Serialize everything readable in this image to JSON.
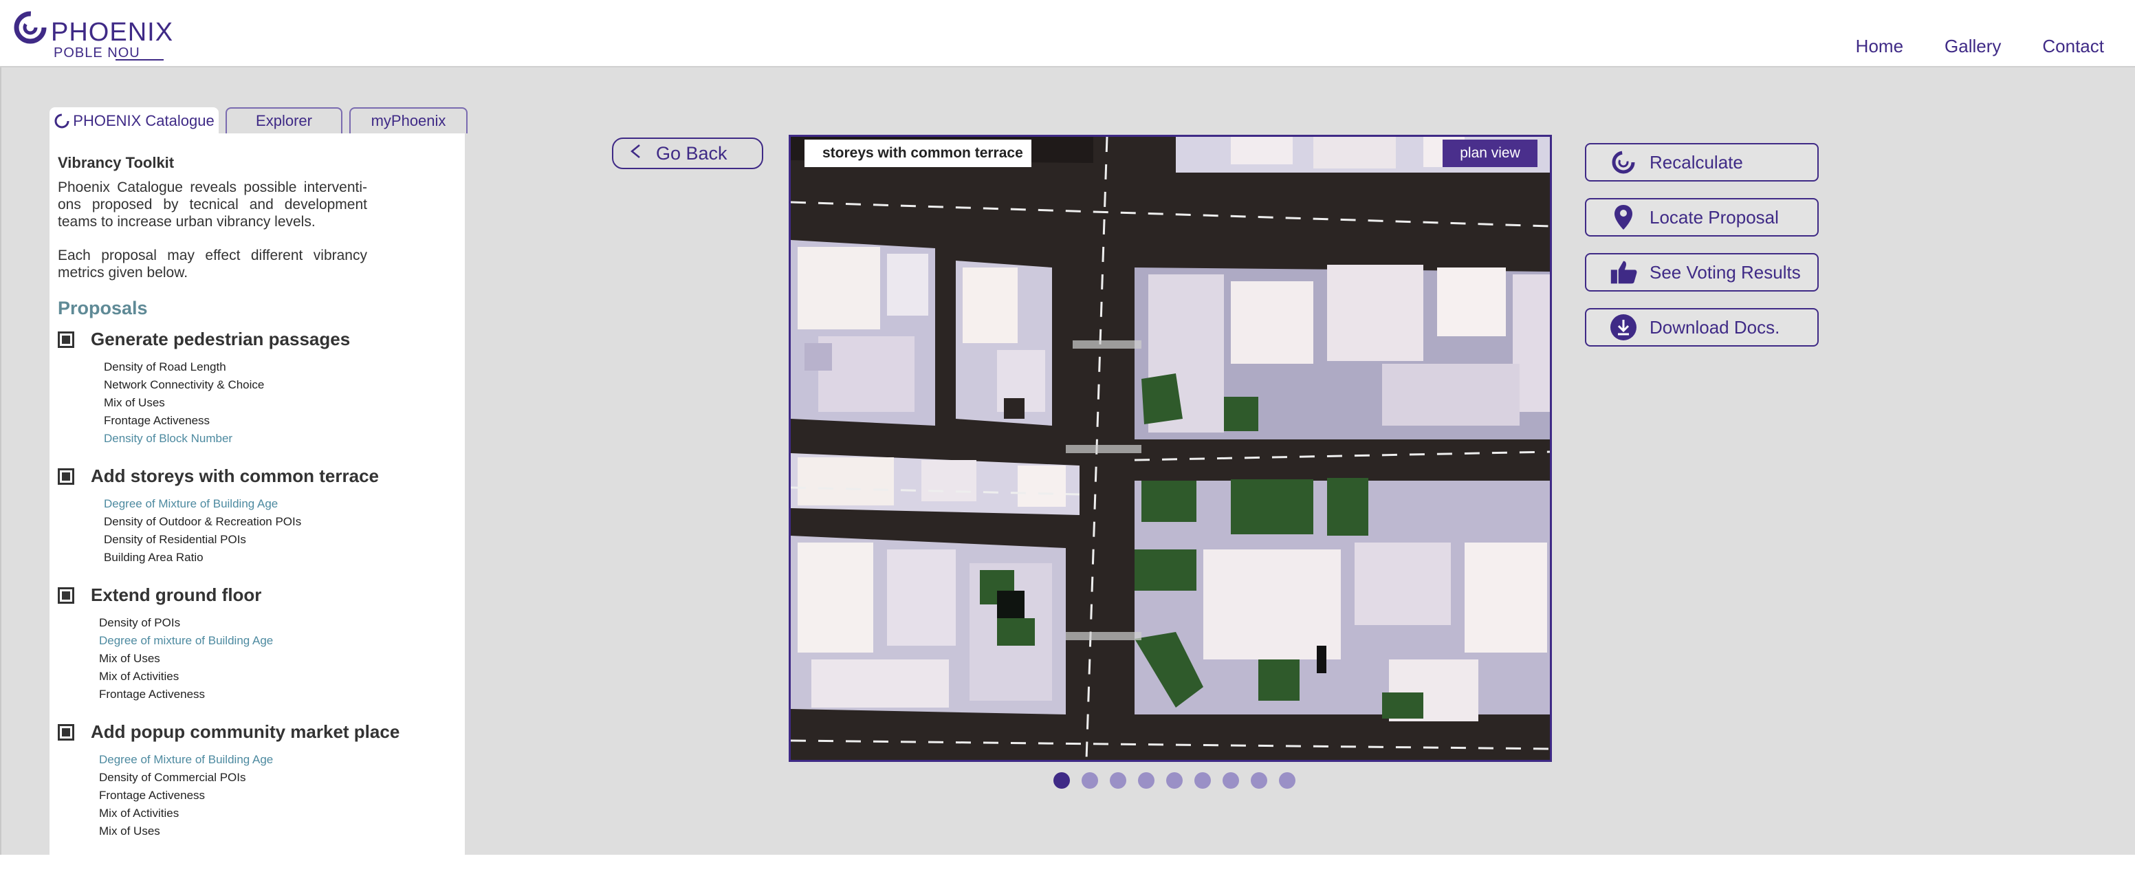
{
  "header": {
    "brand": "PHOENIX",
    "sub": "POBLE NOU",
    "nav": [
      "Home",
      "Gallery",
      "Contact"
    ]
  },
  "tabs": [
    "PHOENIX Catalogue",
    "Explorer",
    "myPhoenix"
  ],
  "panel": {
    "title": "Vibrancy Toolkit",
    "desc1": "Phoenix Catalogue reveals possible interventi-ons proposed by tecnical and development teams to increase urban vibrancy levels.",
    "desc2": "Each proposal may effect different vibrancy metrics given below.",
    "proposals_heading": "Proposals",
    "proposals": [
      {
        "title": "Generate pedestrian passages",
        "metrics": [
          "Density of Road Length",
          "Network Connectivity & Choice",
          "Mix of Uses",
          "Frontage Activeness",
          "Density of Block Number"
        ]
      },
      {
        "title": "Add storeys with common terrace",
        "metrics": [
          "Degree of Mixture of Building Age",
          "Density of Outdoor & Recreation POIs",
          "Density of Residential POIs",
          "Building Area Ratio"
        ]
      },
      {
        "title": "Extend ground floor",
        "metrics": [
          "Density of POIs",
          "Degree of mixture of Building Age",
          "Mix of Uses",
          "Mix of Activities",
          "Frontage Activeness"
        ]
      },
      {
        "title": "Add popup community market place",
        "metrics": [
          "Degree of Mixture of Building Age",
          "Density of Commercial POIs",
          "Frontage Activeness",
          "Mix of Activities",
          "Mix of Uses"
        ]
      }
    ]
  },
  "goback": {
    "label": "Go Back"
  },
  "map": {
    "title": "storeys with common terrace",
    "mode": "plan view",
    "slides_total": 9,
    "slide_active": 1
  },
  "actions": {
    "recalculate": "Recalculate",
    "locate": "Locate Proposal",
    "voting": "See Voting Results",
    "download": "Download Docs."
  },
  "colors": {
    "accent": "#3f2a86",
    "highlight_metric": "#4d8aa0",
    "background": "#dedede",
    "roof_green": "#2f5a2b"
  }
}
